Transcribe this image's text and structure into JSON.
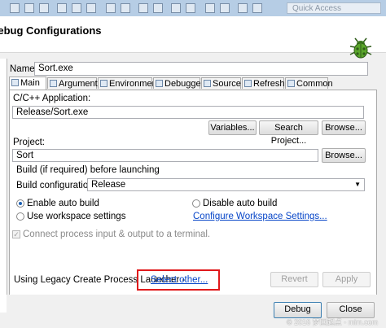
{
  "window": {
    "title": "Debug Configurations",
    "quick_access_placeholder": "Quick Access"
  },
  "config": {
    "name_label": "Name:",
    "name_value": "Sort.exe"
  },
  "tabs": [
    {
      "label": "Main",
      "icon": "main-tab-icon"
    },
    {
      "label": "Arguments",
      "icon": "arguments-tab-icon"
    },
    {
      "label": "Environment",
      "icon": "environment-tab-icon"
    },
    {
      "label": "Debugger",
      "icon": "debugger-tab-icon"
    },
    {
      "label": "Source",
      "icon": "source-tab-icon"
    },
    {
      "label": "Refresh",
      "icon": "refresh-tab-icon"
    },
    {
      "label": "Common",
      "icon": "common-tab-icon"
    }
  ],
  "main": {
    "application_label": "C/C++ Application:",
    "application_value": "Release/Sort.exe",
    "variables_button": "Variables...",
    "search_project_button": "Search Project...",
    "browse_button": "Browse...",
    "project_label": "Project:",
    "project_value": "Sort",
    "project_browse_button": "Browse...",
    "build_heading": "Build (if required) before launching",
    "build_config_label": "Build configuration:",
    "build_config_value": "Release",
    "enable_auto_build": "Enable auto build",
    "disable_auto_build": "Disable auto build",
    "use_workspace_settings": "Use workspace settings",
    "configure_workspace_link": "Configure Workspace Settings...",
    "connect_process_label": "Connect process input & output to a terminal.",
    "launcher_text": "Using Legacy Create Process Launcher -",
    "select_other_link": "Select other...",
    "revert_button": "Revert",
    "apply_button": "Apply"
  },
  "footer": {
    "debug_button": "Debug",
    "close_button": "Close"
  },
  "watermark": "© 2016 梦回起点 - mim.com",
  "colors": {
    "accent_link": "#0645c8",
    "highlight_box": "#e0191b",
    "titlebar": "#b6cde5"
  }
}
